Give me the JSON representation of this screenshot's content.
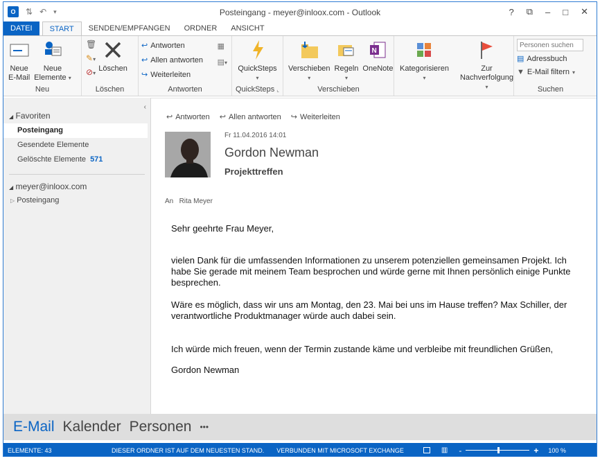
{
  "title": "Posteingang - meyer@inloox.com - Outlook",
  "window_controls": {
    "help": "?",
    "restore": "⧉",
    "minimize": "–",
    "maximize": "□",
    "close": "✕"
  },
  "tabs": [
    {
      "label": "DATEI"
    },
    {
      "label": "START"
    },
    {
      "label": "SENDEN/EMPFANGEN"
    },
    {
      "label": "ORDNER"
    },
    {
      "label": "ANSICHT"
    }
  ],
  "ribbon": {
    "new": {
      "new_email_1": "Neue",
      "new_email_2": "E-Mail",
      "new_items_1": "Neue",
      "new_items_2": "Elemente",
      "group": "Neu"
    },
    "delete": {
      "delete": "Löschen",
      "group": "Löschen"
    },
    "respond": {
      "reply": "Antworten",
      "reply_all": "Allen antworten",
      "forward": "Weiterleiten",
      "group": "Antworten"
    },
    "quicksteps": {
      "label": "QuickSteps",
      "group": "QuickSteps"
    },
    "move": {
      "move": "Verschieben",
      "rules": "Regeln",
      "onenote": "OneNote",
      "group": "Verschieben"
    },
    "tags": {
      "categorize": "Kategorisieren",
      "followup_1": "Zur",
      "followup_2": "Nachverfolgung"
    },
    "find": {
      "search_people": "Personen suchen",
      "address_book": "Adressbuch",
      "filter": "E-Mail filtern",
      "group": "Suchen"
    }
  },
  "nav": {
    "favorites": "Favoriten",
    "fav_items": [
      {
        "label": "Posteingang"
      },
      {
        "label": "Gesendete Elemente"
      },
      {
        "label": "Gelöschte Elemente",
        "count": "571"
      }
    ],
    "account": "meyer@inloox.com",
    "account_items": [
      {
        "label": "Posteingang"
      }
    ]
  },
  "message": {
    "actions": {
      "reply": "Antworten",
      "reply_all": "Allen antworten",
      "forward": "Weiterleiten"
    },
    "date": "Fr 11.04.2016 14:01",
    "sender": "Gordon Newman",
    "subject": "Projekttreffen",
    "to_label": "An",
    "to": "Rita Meyer",
    "body": [
      "Sehr geehrte Frau Meyer,",
      "vielen Dank für die umfassenden Informationen zu unserem potenziellen gemeinsamen Projekt. Ich habe Sie gerade mit meinem Team besprochen und würde gerne mit Ihnen persönlich einige Punkte besprechen.",
      "Wäre es möglich, dass wir uns am Montag, den 23. Mai bei uns im Hause treffen? Max Schiller, der verantwortliche Produktmanager würde auch dabei sein.",
      "Ich würde mich freuen, wenn der Termin zustande käme und verbleibe mit freundlichen Grüßen,",
      "Gordon Newman"
    ]
  },
  "bottom_nav": [
    {
      "label": "E-Mail"
    },
    {
      "label": "Kalender"
    },
    {
      "label": "Personen"
    },
    {
      "label": "•••"
    }
  ],
  "status": {
    "items": "ELEMENTE: 43",
    "folder": "DIESER ORDNER IST AUF DEM NEUESTEN STAND.",
    "connection": "VERBUNDEN MIT MICROSOFT EXCHANGE",
    "zoom_minus": "-",
    "zoom_plus": "+",
    "zoom": "100 %",
    "zoom_level": 0.5
  },
  "colors": {
    "accent": "#0a64c4",
    "followup_flag": "#e84e3c"
  }
}
